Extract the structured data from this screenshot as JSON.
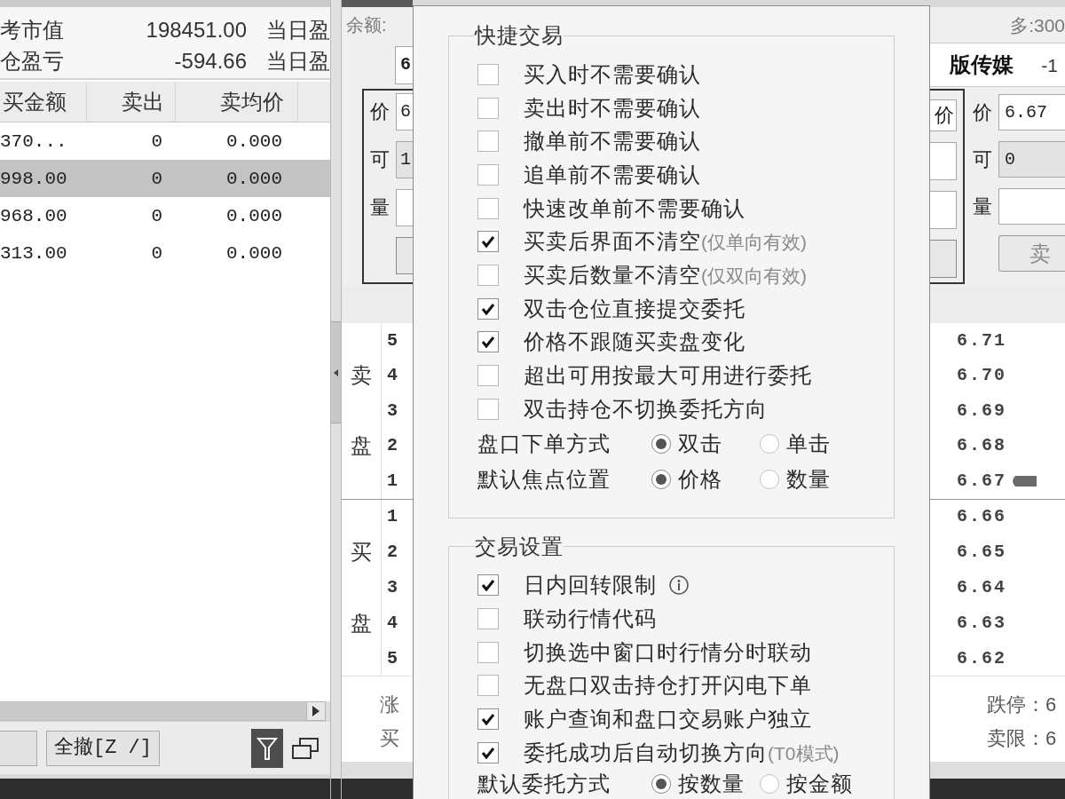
{
  "positions_panel": {
    "summary": [
      {
        "label": "考市值",
        "value": "198451.00",
        "label_2": "当日盈"
      },
      {
        "label": "仓盈亏",
        "value": "-594.66",
        "label_2": "当日盈"
      }
    ],
    "columns": [
      "买金额",
      "卖出",
      "卖均价"
    ],
    "rows": [
      {
        "cells": [
          "370...",
          "0",
          "0.000"
        ],
        "selected": false
      },
      {
        "cells": [
          "998.00",
          "0",
          "0.000"
        ],
        "selected": true
      },
      {
        "cells": [
          "968.00",
          "0",
          "0.000"
        ],
        "selected": false
      },
      {
        "cells": [
          "313.00",
          "0",
          "0.000"
        ],
        "selected": false
      }
    ],
    "toolbar_buttons": [
      "全撤[Z /]"
    ]
  },
  "buy_panel": {
    "balance": "余额:",
    "code": "6",
    "fields": [
      {
        "label": "价",
        "value": "6",
        "disabled": false
      },
      {
        "label": "可",
        "value": "1",
        "disabled": true
      },
      {
        "label": "量",
        "disabled": false
      }
    ],
    "right_edge_label": "价"
  },
  "order_book": {
    "sides": [
      {
        "label": [
          "卖",
          "盘"
        ],
        "levels": [
          {
            "level": "5",
            "price": "6.71",
            "current": false
          },
          {
            "level": "4",
            "price": "6.70",
            "current": false
          },
          {
            "level": "3",
            "price": "6.69",
            "current": false
          },
          {
            "level": "2",
            "price": "6.68",
            "current": false
          },
          {
            "level": "1",
            "price": "6.67",
            "current": true
          }
        ]
      },
      {
        "label": [
          "买",
          "盘"
        ],
        "levels": [
          {
            "level": "1",
            "price": "6.66",
            "current": false
          },
          {
            "level": "2",
            "price": "6.65",
            "current": false
          },
          {
            "level": "3",
            "price": "6.64",
            "current": false
          },
          {
            "level": "4",
            "price": "6.63",
            "current": false
          },
          {
            "level": "5",
            "price": "6.62",
            "current": false
          }
        ]
      }
    ],
    "limits": [
      "涨",
      "买"
    ]
  },
  "settings_dialog": {
    "groups": [
      {
        "title": "快捷交易",
        "options": [
          {
            "label": "买入时不需要确认",
            "checked": false
          },
          {
            "label": "卖出时不需要确认",
            "checked": false
          },
          {
            "label": "撤单前不需要确认",
            "checked": false
          },
          {
            "label": "追单前不需要确认",
            "checked": false
          },
          {
            "label": "快速改单前不需要确认",
            "checked": false
          },
          {
            "label": "买卖后界面不清空",
            "note": "(仅单向有效)",
            "checked": true
          },
          {
            "label": "买卖后数量不清空",
            "note": "(仅双向有效)",
            "checked": false
          },
          {
            "label": "双击仓位直接提交委托",
            "checked": true
          },
          {
            "label": "价格不跟随买卖盘变化",
            "checked": true
          },
          {
            "label": "超出可用按最大可用进行委托",
            "checked": false
          },
          {
            "label": "双击持仓不切换委托方向",
            "checked": false
          }
        ],
        "radio_rows": [
          {
            "label": "盘口下单方式",
            "choices": [
              {
                "label": "双击",
                "selected": true
              },
              {
                "label": "单击",
                "selected": false
              }
            ]
          },
          {
            "label": "默认焦点位置",
            "choices": [
              {
                "label": "价格",
                "selected": true
              },
              {
                "label": "数量",
                "selected": false
              }
            ]
          }
        ]
      },
      {
        "title": "交易设置",
        "options": [
          {
            "label": "日内回转限制",
            "checked": true,
            "info": true
          },
          {
            "label": "联动行情代码",
            "checked": false,
            "info": false
          },
          {
            "label": "切换选中窗口时行情分时联动",
            "checked": false,
            "info": false
          },
          {
            "label": "无盘口双击持仓打开闪电下单",
            "checked": false,
            "info": false
          },
          {
            "label": "账户查询和盘口交易账户独立",
            "checked": true,
            "info": false
          },
          {
            "label": "委托成功后自动切换方向",
            "note": "(T0模式)",
            "checked": true,
            "info": false
          }
        ],
        "radio_rows": [
          {
            "label": "默认委托方式",
            "choices": [
              {
                "label": "按数量",
                "selected": true
              },
              {
                "label": "按金额",
                "selected": false
              }
            ]
          }
        ]
      }
    ]
  },
  "sell_panel": {
    "position": "多:300",
    "stock_name": "版传媒",
    "change": "-1",
    "fields": [
      {
        "label": "价",
        "value": "6.67",
        "disabled": false
      },
      {
        "label": "可",
        "value": "0",
        "disabled": true
      },
      {
        "label": "量",
        "disabled": false
      }
    ],
    "submit": "卖",
    "limits": [
      "跌停：6",
      "卖限：6"
    ]
  }
}
